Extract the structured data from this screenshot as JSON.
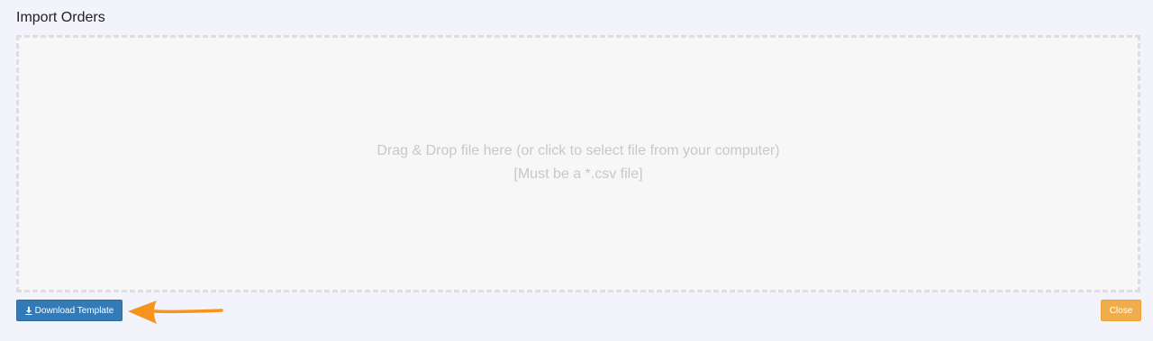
{
  "page": {
    "title": "Import Orders"
  },
  "dropzone": {
    "line1": "Drag & Drop file here (or click to select file from your computer)",
    "line2": "[Must be a *.csv file]"
  },
  "buttons": {
    "download_label": "Download Template",
    "download_icon": "download-icon",
    "close_label": "Close"
  },
  "annotation": {
    "arrow_icon": "arrow-left-icon",
    "arrow_color": "#f7941d"
  },
  "colors": {
    "primary": "#337ab7",
    "warning": "#f0ad4e",
    "background": "#f3f3fb",
    "dropzone_bg": "#f7f7f7",
    "dropzone_text": "#c8c8c8"
  }
}
